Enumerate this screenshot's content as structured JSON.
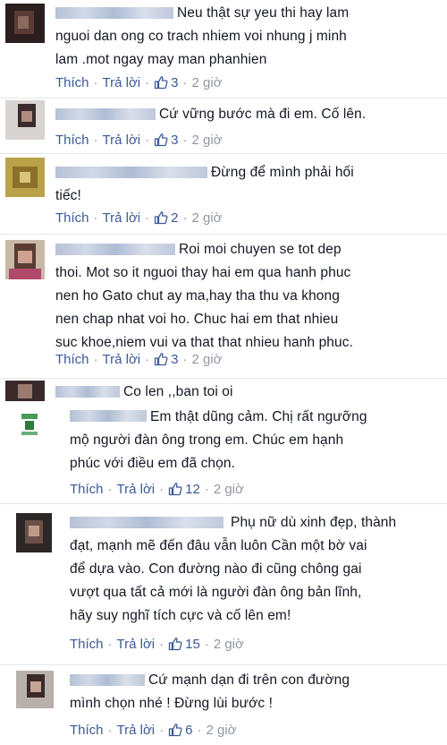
{
  "labels": {
    "like": "Thích",
    "reply": "Trả lời"
  },
  "colors": {
    "link": "#3b5998",
    "muted": "#9197a3",
    "text": "#141823",
    "separator": "#e5e6e9"
  },
  "comments": [
    {
      "lines": [
        "Neu thật sự yeu thi hay lam",
        "nguoi dan ong co trach nhiem voi nhung j minh",
        "lam .mot ngay may man phanhien"
      ],
      "likes": "3",
      "time": "2 giờ",
      "avatar_icon": "blurred-profile-photo"
    },
    {
      "lines": [
        "Cứ vững bước mà đi em. Cố lên."
      ],
      "likes": "3",
      "time": "2 giờ",
      "avatar_icon": "blurred-profile-photo"
    },
    {
      "lines": [
        "Đừng để mình phải hối",
        "tiếc!"
      ],
      "likes": "2",
      "time": "2 giờ",
      "avatar_icon": "blurred-profile-photo"
    },
    {
      "lines": [
        "Roi moi chuyen se tot dep",
        "thoi. Mot so it nguoi thay hai em qua hanh phuc",
        "nen ho Gato chut ay ma,hay tha thu va khong",
        "nen chap nhat voi ho. Chuc hai em that nhieu",
        "suc khoe,niem vui va that that nhieu hanh phuc."
      ],
      "likes": "3",
      "time": "2 giờ",
      "avatar_icon": "blurred-profile-photo"
    },
    {
      "lines": [
        "Co len ,,ban toi oi"
      ],
      "avatar_icon": "blurred-profile-photo"
    },
    {
      "lines": [
        "Em thật dũng cảm. Chị rất ngưỡng",
        "mộ người đàn ông trong em. Chúc em hạnh",
        "phúc với điều em đã chọn."
      ],
      "likes": "12",
      "time": "2 giờ",
      "avatar_icon": "blurred-profile-photo"
    },
    {
      "lines": [
        "Phụ nữ dù xinh đẹp, thành",
        "đạt, mạnh mẽ đến đâu vẫn luôn Cần một bờ vai",
        "để dựa vào. Con đường nào đi cũng chông gai",
        "vượt qua tất cả mới là người đàn ông bản lĩnh,",
        "hãy suy nghĩ tích cực và cố lên em!"
      ],
      "likes": "15",
      "time": "2 giờ",
      "avatar_icon": "blurred-profile-photo"
    },
    {
      "lines": [
        "Cứ mạnh dạn đi trên con đường",
        "mình chọn nhé ! Đừng lùi bước !"
      ],
      "likes": "6",
      "time": "2 giờ",
      "avatar_icon": "blurred-profile-photo"
    }
  ]
}
